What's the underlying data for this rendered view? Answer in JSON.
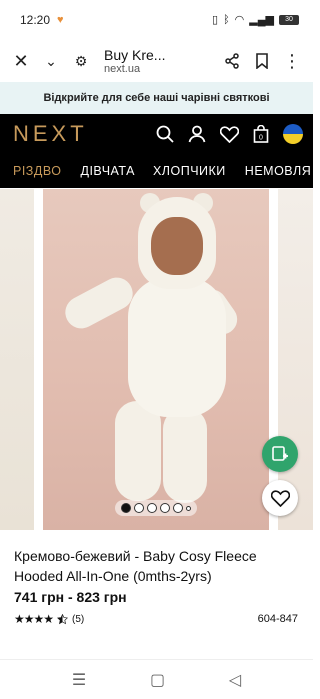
{
  "status_bar": {
    "time": "12:20",
    "battery": "30"
  },
  "browser": {
    "page_title": "Buy Kre...",
    "domain": "next.ua"
  },
  "promo_banner": "Відкрийте для себе наші чарівні святкові",
  "store": {
    "logo": "NEXT"
  },
  "categories": [
    "РІЗДВО",
    "ДІВЧАТА",
    "ХЛОПЧИКИ",
    "НЕМОВЛЯ"
  ],
  "gallery": {
    "dot_count": 6,
    "active_dot": 0
  },
  "product": {
    "name": "Кремово-бежевий - Baby Cosy Fleece Hooded All-In-One (0mths-2yrs)",
    "price": "741 грн - 823 грн",
    "rating": 4.5,
    "review_count": "(5)",
    "sku": "604-847"
  },
  "colors": {
    "brand_gold": "#c79a5b",
    "promo_bg": "#e8f3f4",
    "fab_green": "#30a46c"
  }
}
